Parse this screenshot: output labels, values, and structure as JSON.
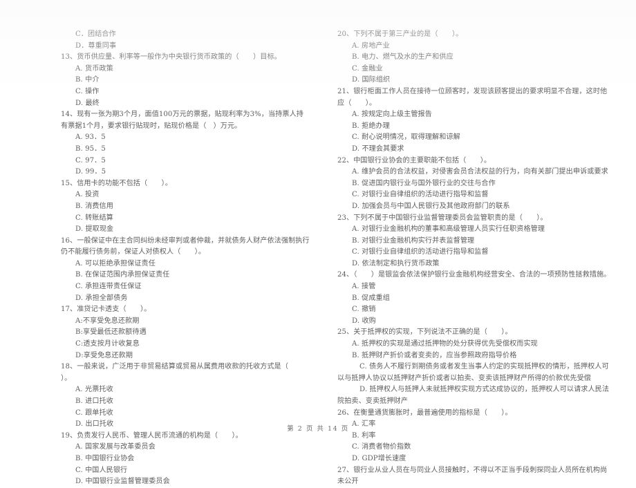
{
  "document": {
    "type": "scanned-exam-paper",
    "language": "zh-CN",
    "footer": "第 2 页 共 14 页"
  },
  "left_column": [
    {
      "id": "q12-tail",
      "kind": "options-tail",
      "options": [
        "C．团结合作",
        "D．尊重同事"
      ]
    },
    {
      "id": "q13",
      "number": "13、",
      "stem": "13、货币供应量、利率等一般作为中央银行货币政策的（　　）目标。",
      "options": [
        "A. 货币政策",
        "B. 中介",
        "C. 操作",
        "D. 最终"
      ]
    },
    {
      "id": "q14",
      "number": "14、",
      "stem": "14、现有一张为期3个月，面值100万元的票据，贴现利率为3%，当持票人持有票据1个月，要求银行贴现时，贴现价格是（　）万元。",
      "options": [
        "A. 93．5",
        "B. 95．5",
        "C. 97．5",
        "D. 99．5"
      ]
    },
    {
      "id": "q15",
      "number": "15、",
      "stem": "15、信用卡的功能不包括（　　）。",
      "options": [
        "A. 投资",
        "B. 消费信用",
        "C. 转账结算",
        "D. 提取现金"
      ]
    },
    {
      "id": "q16",
      "number": "16、",
      "stem": "16、一般保证中在主合同纠纷未经审判或者仲裁，并就债务人财产依法强制执行仍不能履行债务前，保证人对债权人（　　）。",
      "options": [
        "A. 可以拒绝承担保证责任",
        "B. 在保证范围内承担保证责任",
        "C. 承担连带责任保证",
        "D. 承担全部债务"
      ]
    },
    {
      "id": "q17",
      "number": "17、",
      "stem": "17、准贷记卡透支（　　）。",
      "options": [
        "A:不享受免息还款期",
        "B:享受最低还款额待遇",
        "C:透支按月计收复息",
        "D:享受免息还款期"
      ]
    },
    {
      "id": "q18",
      "number": "18、",
      "stem": "18、一般来说，广泛用于非贸易结算或贸易从属费用收款的托收方式是（　　）。",
      "options": [
        "A. 光票托收",
        "B. 进口托收",
        "C. 跟单托收",
        "D. 出口托收"
      ]
    },
    {
      "id": "q19",
      "number": "19、",
      "stem": "19、负责发行人民币、管理人民币流通的机构是（　　）。",
      "options": [
        "A. 国家发展与改革委员会",
        "B. 中国银行业协会",
        "C. 中国人民银行",
        "D. 中国银行业监督管理委员会"
      ]
    }
  ],
  "right_column": [
    {
      "id": "q20",
      "number": "20、",
      "stem": "20、下列不属于第三产业的是（　　）。",
      "options": [
        "A. 房地产业",
        "B. 电力、燃气及水的生产和供应",
        "C. 金融业",
        "D. 国际组织"
      ]
    },
    {
      "id": "q21",
      "number": "21、",
      "stem": "21、银行柜面工作人员在接待一位顾客时，发现该顾客提出的要求明显不合理，这时他应（　　）。",
      "options": [
        "A. 按规定向上级主管报告",
        "B. 拒绝办理",
        "C. 耐心说明情况，取得理解和谅解",
        "D. 不理会其要求"
      ]
    },
    {
      "id": "q22",
      "number": "22、",
      "stem": "22、中国银行业协会的主要职能不包括（　　）。",
      "options": [
        "A. 维护会员的合法权益，对侵害会员合法权益的行为，向有关部门提出申诉或要求",
        "B. 促进国内银行业与国外银行业的交往与合作",
        "C. 对银行业自律组织的活动进行指导和监督",
        "D. 加强会员与中国人民银行及其他政府部门的联系"
      ]
    },
    {
      "id": "q23",
      "number": "23、",
      "stem": "23、下列不属于中国银行业监督管理委员会监管职责的是（　　）。",
      "options": [
        "A. 对银行业金融机构的董事和高级管理人员实行任职资格管理",
        "B. 对银行业金融机构实行并表监督管理",
        "C. 对银行业自律组织的活动进行指导和监督",
        "D. 依法制定和执行货币政策"
      ]
    },
    {
      "id": "q24",
      "number": "24、",
      "stem": "24、（　　）是银监会依法保护银行业金融机构经营安全、合法的一项预防性拯救措施。",
      "options": [
        "A. 接管",
        "B. 促成重组",
        "C. 撤销",
        "D. 收购"
      ]
    },
    {
      "id": "q25",
      "number": "25、",
      "stem": "25、关于抵押权的实现，下列说法不正确的是（　　）。",
      "options": [
        "A. 抵押权的实现是通过抵押物的处分获得优先受偿权而实现",
        "B. 抵押财产折价或者变卖的，应当参照政府指导价格",
        "C. 债务人不履行到期债务或者发生当事人约定的实现抵押权的情形，抵押权人可以与抵押人协议以抵押财产折价或者以拍卖、变卖该抵押财产所得的价款优先受偿",
        "D. 抵押权人与抵押人未就抵押权实现方式达成协议的，抵押权人可以请求人民法院拍卖、变卖抵押财产"
      ]
    },
    {
      "id": "q26",
      "number": "26、",
      "stem": "26、在衡量通货膨胀时，最普遍使用的指标是（　　）。",
      "options": [
        "A. 汇率",
        "B. 利率",
        "C. 消费者物价指数",
        "D. GDP增长速度"
      ]
    },
    {
      "id": "q27",
      "number": "27、",
      "stem": "27、银行业从业人员在与同业人员接触时，不得以不正当手段刺探同业人员所在机构尚未公开",
      "options": []
    }
  ]
}
